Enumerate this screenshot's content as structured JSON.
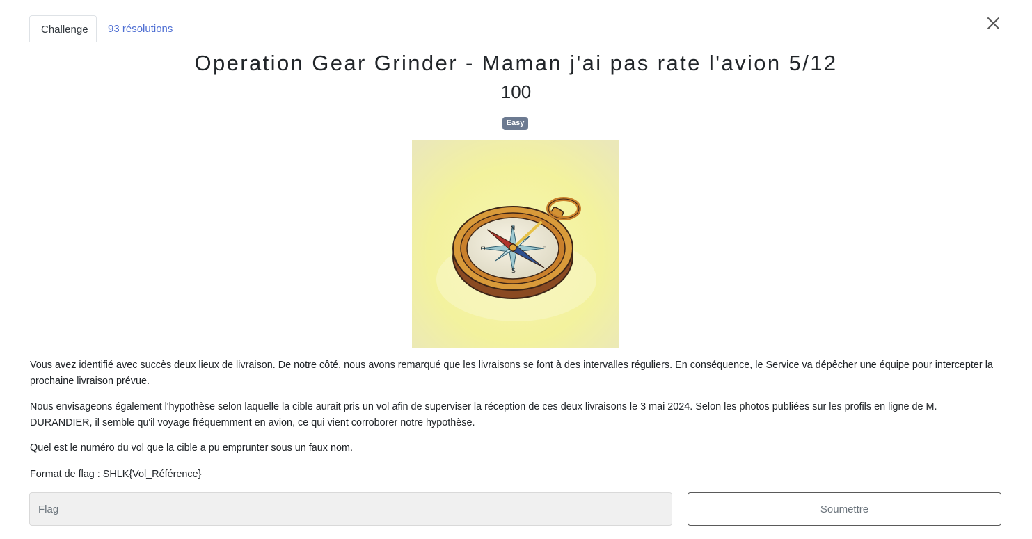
{
  "tabs": [
    {
      "label": "Challenge",
      "active": true
    },
    {
      "label": "93 résolutions",
      "active": false
    }
  ],
  "challenge": {
    "title": "Operation Gear Grinder - Maman j'ai pas rate l'avion 5/12",
    "points": "100",
    "difficulty": "Easy",
    "image_icon": "compass-illustration",
    "description": [
      "Vous avez identifié avec succès deux lieux de livraison. De notre côté, nous avons remarqué que les livraisons se font à des intervalles réguliers. En conséquence, le Service va dépêcher une équipe pour intercepter la prochaine livraison prévue.",
      "Nous envisageons également l'hypothèse selon laquelle la cible aurait pris un vol afin de superviser la réception de ces deux livraisons le 3 mai 2024. Selon les photos publiées sur les profils en ligne de M. DURANDIER, il semble qu'il voyage fréquemment en avion, ce qui vient corroborer notre hypothèse.",
      "Quel est le numéro du vol que la cible a pu emprunter sous un faux nom.",
      "Format de flag : SHLK{Vol_Référence}"
    ]
  },
  "form": {
    "flag_placeholder": "Flag",
    "flag_value": "",
    "submit_label": "Soumettre"
  },
  "icons": {
    "close": "close-icon"
  },
  "colors": {
    "link": "#4f6fd3",
    "badge": "#6c7a91",
    "input_bg": "#f0f0f0"
  }
}
